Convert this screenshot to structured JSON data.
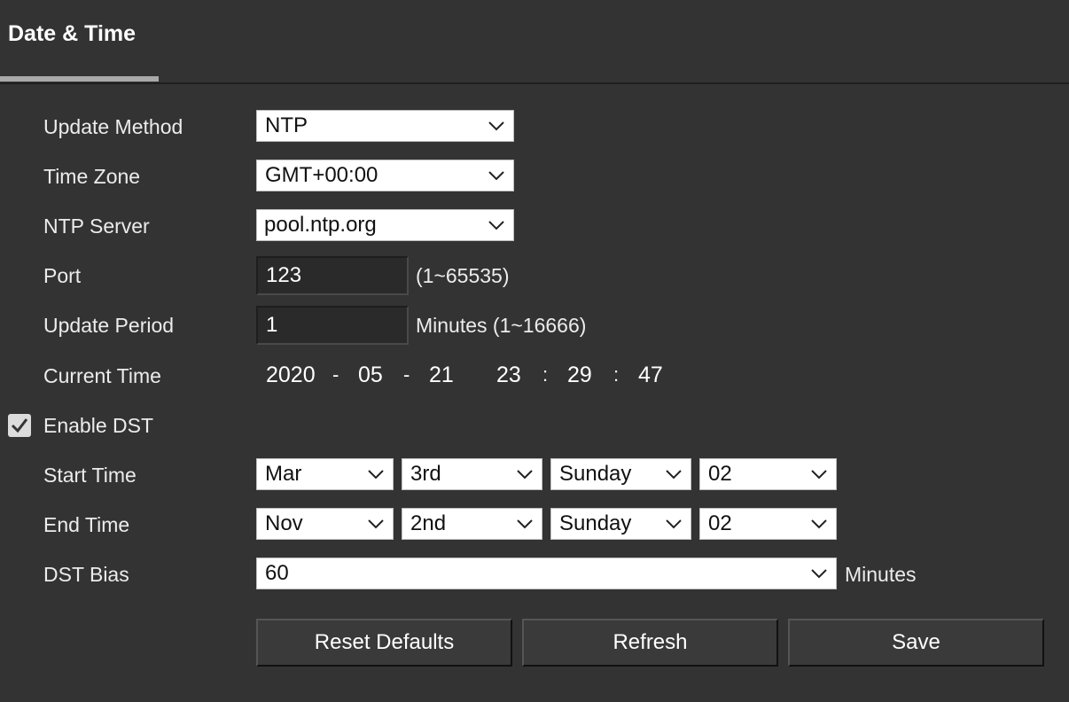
{
  "tab": {
    "title": "Date & Time"
  },
  "form": {
    "update_method": {
      "label": "Update Method",
      "value": "NTP"
    },
    "time_zone": {
      "label": "Time Zone",
      "value": "GMT+00:00"
    },
    "ntp_server": {
      "label": "NTP Server",
      "value": "pool.ntp.org"
    },
    "port": {
      "label": "Port",
      "value": "123",
      "hint": "(1~65535)"
    },
    "update_period": {
      "label": "Update Period",
      "value": "1",
      "hint": "Minutes (1~16666)"
    },
    "current_time": {
      "label": "Current Time",
      "year": "2020",
      "month": "05",
      "day": "21",
      "hour": "23",
      "minute": "29",
      "second": "47",
      "date_sep": "-",
      "time_sep": ":"
    },
    "enable_dst": {
      "label": "Enable DST",
      "checked": true
    },
    "start_time": {
      "label": "Start Time",
      "month": "Mar",
      "week": "3rd",
      "weekday": "Sunday",
      "hour": "02"
    },
    "end_time": {
      "label": "End Time",
      "month": "Nov",
      "week": "2nd",
      "weekday": "Sunday",
      "hour": "02"
    },
    "dst_bias": {
      "label": "DST Bias",
      "value": "60",
      "unit": "Minutes"
    }
  },
  "buttons": {
    "reset": "Reset Defaults",
    "refresh": "Refresh",
    "save": "Save"
  },
  "colors": {
    "background": "#333333",
    "tab_underline": "#a9a9a9",
    "select_bg": "#ffffff",
    "text": "#ececec"
  }
}
